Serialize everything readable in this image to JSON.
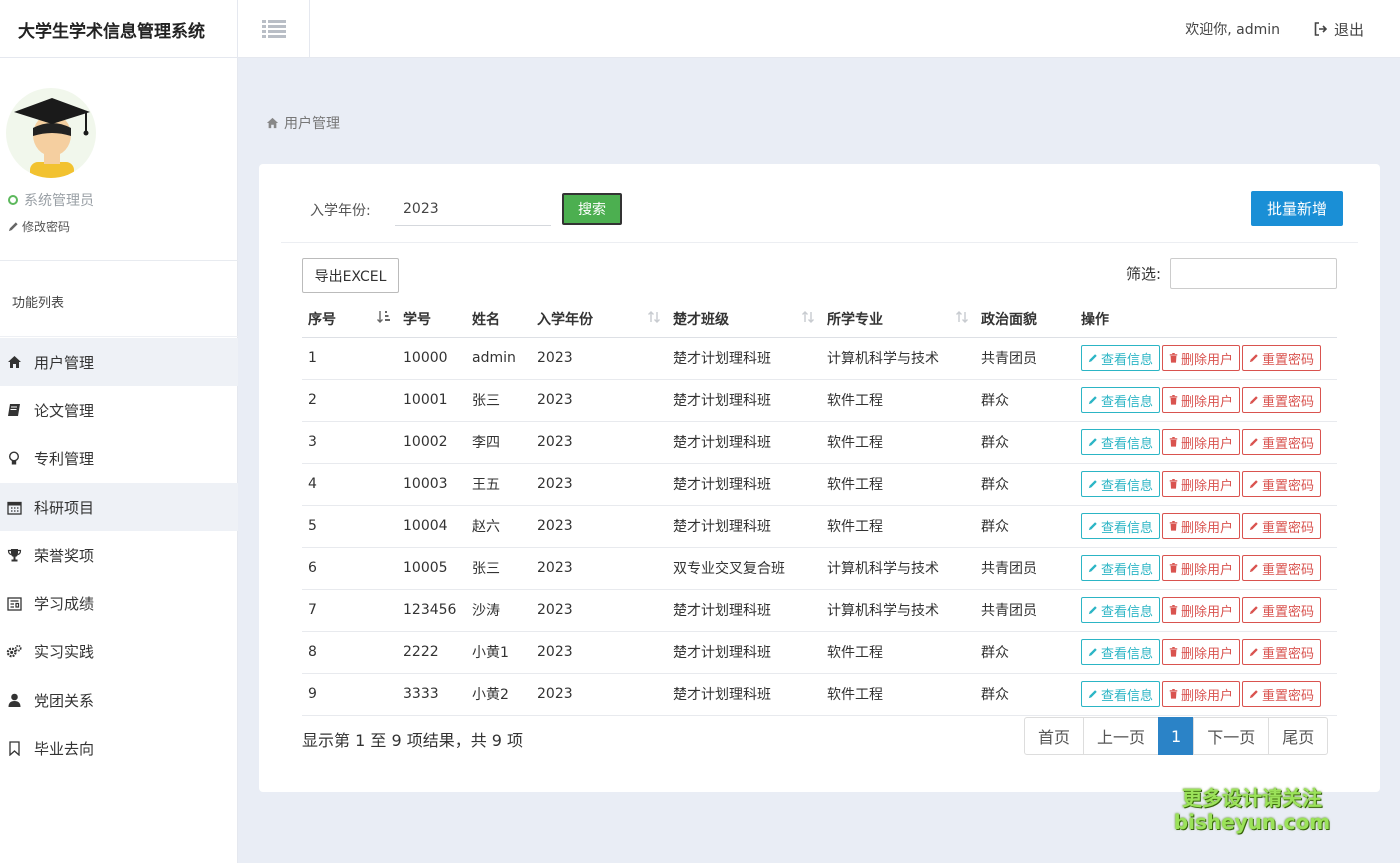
{
  "app": {
    "title": "大学生学术信息管理系统"
  },
  "header": {
    "welcome": "欢迎你, admin",
    "logout": "退出"
  },
  "sidebar": {
    "role": "系统管理员",
    "change_password": "修改密码",
    "section_title": "功能列表",
    "items": [
      {
        "label": "用户管理",
        "icon": "home-icon"
      },
      {
        "label": "论文管理",
        "icon": "book-icon"
      },
      {
        "label": "专利管理",
        "icon": "lightbulb-icon"
      },
      {
        "label": "科研项目",
        "icon": "calendar-icon"
      },
      {
        "label": "荣誉奖项",
        "icon": "trophy-icon"
      },
      {
        "label": "学习成绩",
        "icon": "newspaper-icon"
      },
      {
        "label": "实习实践",
        "icon": "gears-icon"
      },
      {
        "label": "党团关系",
        "icon": "user-icon"
      },
      {
        "label": "毕业去向",
        "icon": "bookmark-icon"
      }
    ]
  },
  "breadcrumb": {
    "label": "用户管理"
  },
  "search": {
    "label": "入学年份:",
    "value": "2023",
    "button": "搜索"
  },
  "toolbar": {
    "batch_add": "批量新增",
    "export": "导出EXCEL",
    "filter_label": "筛选:",
    "filter_value": ""
  },
  "table": {
    "headers": [
      "序号",
      "学号",
      "姓名",
      "入学年份",
      "楚才班级",
      "所学专业",
      "政治面貌",
      "操作"
    ],
    "actions": [
      "查看信息",
      "删除用户",
      "重置密码"
    ],
    "rows": [
      [
        "1",
        "10000",
        "admin",
        "2023",
        "楚才计划理科班",
        "计算机科学与技术",
        "共青团员"
      ],
      [
        "2",
        "10001",
        "张三",
        "2023",
        "楚才计划理科班",
        "软件工程",
        "群众"
      ],
      [
        "3",
        "10002",
        "李四",
        "2023",
        "楚才计划理科班",
        "软件工程",
        "群众"
      ],
      [
        "4",
        "10003",
        "王五",
        "2023",
        "楚才计划理科班",
        "软件工程",
        "群众"
      ],
      [
        "5",
        "10004",
        "赵六",
        "2023",
        "楚才计划理科班",
        "软件工程",
        "群众"
      ],
      [
        "6",
        "10005",
        "张三",
        "2023",
        "双专业交叉复合班",
        "计算机科学与技术",
        "共青团员"
      ],
      [
        "7",
        "123456",
        "沙涛",
        "2023",
        "楚才计划理科班",
        "计算机科学与技术",
        "共青团员"
      ],
      [
        "8",
        "2222",
        "小黄1",
        "2023",
        "楚才计划理科班",
        "软件工程",
        "群众"
      ],
      [
        "9",
        "3333",
        "小黄2",
        "2023",
        "楚才计划理科班",
        "软件工程",
        "群众"
      ]
    ]
  },
  "pagination": {
    "summary": "显示第 1 至 9 项结果，共 9 项",
    "first": "首页",
    "prev": "上一页",
    "current": "1",
    "next": "下一页",
    "last": "尾页"
  },
  "watermark": {
    "line1": "更多设计请关注",
    "line2": "bisheyun.com"
  },
  "colors": {
    "primary": "#1a8fd6",
    "search_green": "#4caf50",
    "view": "#2cb5c5",
    "danger": "#d9534f",
    "page_active": "#2b83c7"
  }
}
